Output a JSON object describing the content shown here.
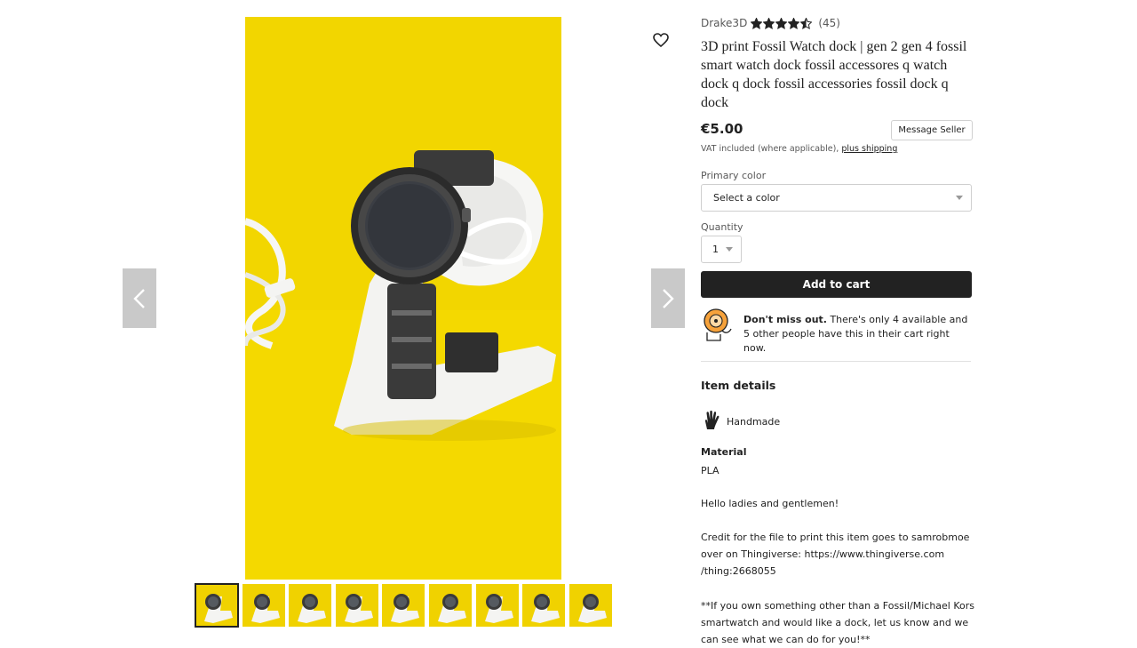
{
  "gallery": {
    "thumbnail_count": 9,
    "active_index": 0,
    "image_bg": "#f2d600"
  },
  "shop": {
    "name": "Drake3D",
    "rating_stars": 4.5,
    "review_count": "(45)"
  },
  "product": {
    "title": "3D print Fossil Watch dock | gen 2 gen 4 fossil smart watch dock fossil accessores q watch dock q dock fossil accessories fossil dock q dock",
    "price": "€5.00",
    "message_seller_label": "Message Seller",
    "vat_text": "VAT included (where applicable),",
    "shipping_link": "plus shipping"
  },
  "options": {
    "color_label": "Primary color",
    "color_value": "Select a color",
    "quantity_label": "Quantity",
    "quantity_value": "1"
  },
  "cart": {
    "add_label": "Add to cart"
  },
  "urgency": {
    "bold": "Don't miss out.",
    "text": " There's only 4 available and 5 other people have this in their cart right now."
  },
  "details": {
    "heading": "Item details",
    "handmade": "Handmade",
    "material_heading": "Material",
    "material_value": "PLA",
    "description_lines": [
      [
        "Hello ladies and gentlemen!"
      ],
      [
        "Credit for the file to print this item goes to samrobmoe",
        "over on Thingiverse: https://www.thingiverse.com",
        "/thing:2668055"
      ],
      [
        "**If you own something other than a Fossil/Michael Kors",
        "smartwatch and would like a dock, let us know and we",
        "can see what we can do for you!**"
      ]
    ]
  },
  "colors": {
    "accent_button": "#222222",
    "star": "#222222",
    "urgency_orange": "#f1641e"
  }
}
